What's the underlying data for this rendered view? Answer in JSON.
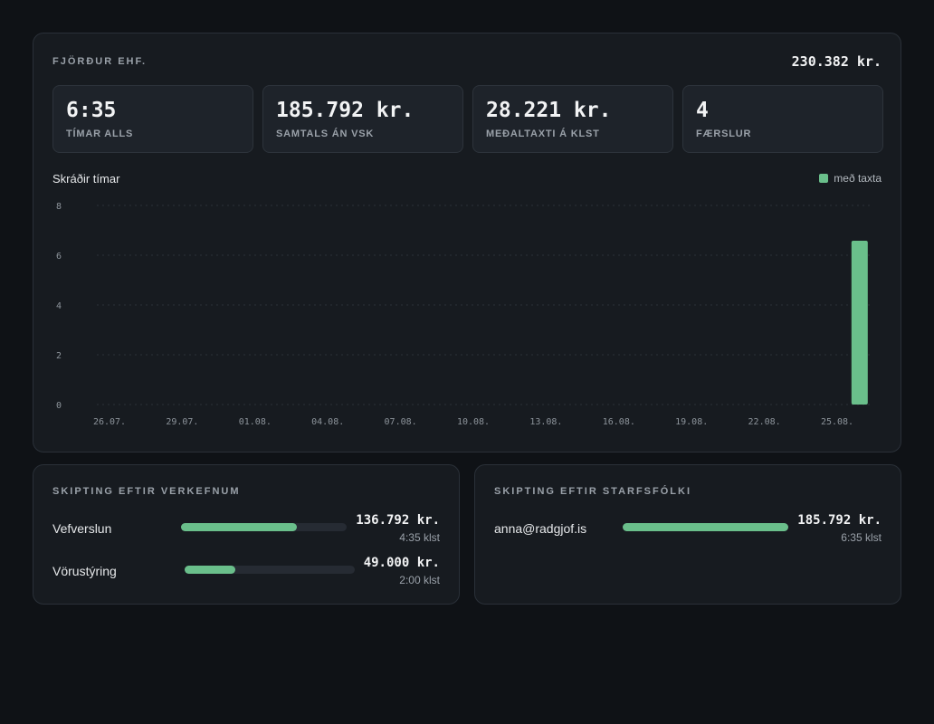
{
  "company": {
    "name": "FJÖRÐUR EHF.",
    "total": "230.382 kr."
  },
  "stats": [
    {
      "value": "6:35",
      "label": "TÍMAR ALLS"
    },
    {
      "value": "185.792 kr.",
      "label": "SAMTALS ÁN VSK"
    },
    {
      "value": "28.221 kr.",
      "label": "MEÐALTAXTI Á KLST"
    },
    {
      "value": "4",
      "label": "FÆRSLUR"
    }
  ],
  "chart": {
    "legend_label": "með taxta",
    "accent": "#6abf8b"
  },
  "chart_data": {
    "type": "bar",
    "title": "Skráðir tímar",
    "legend": [
      "með taxta"
    ],
    "legend_position": "top-right",
    "ylim": [
      0,
      8
    ],
    "y_ticks": [
      "0",
      "2",
      "4",
      "6",
      "8"
    ],
    "x_ticks": [
      "26.07.",
      "29.07.",
      "01.08.",
      "04.08.",
      "07.08.",
      "10.08.",
      "13.08.",
      "16.08.",
      "19.08.",
      "22.08.",
      "25.08."
    ],
    "grid": true,
    "series": [
      {
        "name": "með taxta",
        "points": [
          {
            "date": "26.08.",
            "hours": 6.58
          }
        ]
      }
    ]
  },
  "projects": {
    "title": "SKIPTING EFTIR VERKEFNUM",
    "rows": [
      {
        "name": "Vefverslun",
        "amount": "136.792 kr.",
        "hours": "4:35 klst",
        "fraction": 0.7
      },
      {
        "name": "Vörustýring",
        "amount": "49.000 kr.",
        "hours": "2:00 klst",
        "fraction": 0.3
      }
    ]
  },
  "staff": {
    "title": "SKIPTING EFTIR STARFSFÓLKI",
    "rows": [
      {
        "name": "anna@radgjof.is",
        "amount": "185.792 kr.",
        "hours": "6:35 klst",
        "fraction": 1.0
      }
    ]
  }
}
